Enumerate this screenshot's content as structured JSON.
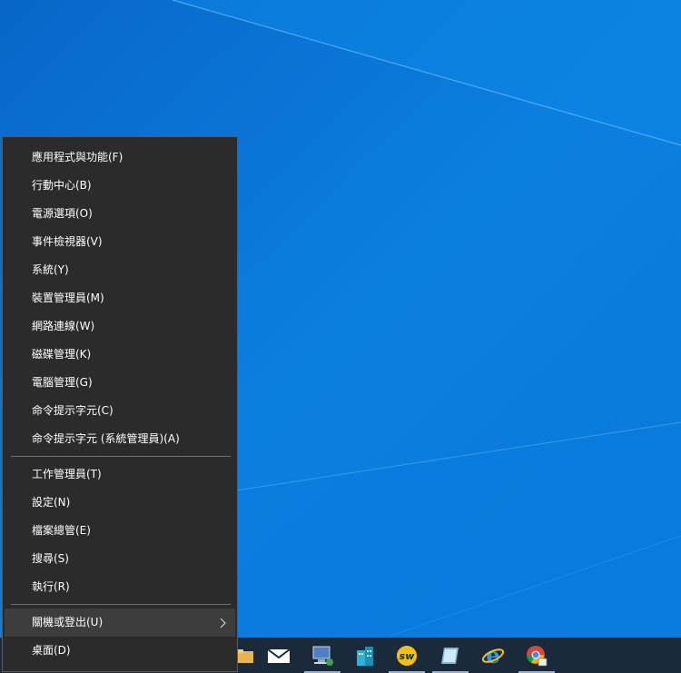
{
  "start_menu": {
    "group1": [
      {
        "label": "應用程式與功能(F)"
      },
      {
        "label": "行動中心(B)"
      },
      {
        "label": "電源選項(O)"
      },
      {
        "label": "事件檢視器(V)"
      },
      {
        "label": "系統(Y)"
      },
      {
        "label": "裝置管理員(M)"
      },
      {
        "label": "網路連線(W)"
      },
      {
        "label": "磁碟管理(K)"
      },
      {
        "label": "電腦管理(G)"
      },
      {
        "label": "命令提示字元(C)"
      },
      {
        "label": "命令提示字元 (系統管理員)(A)"
      }
    ],
    "group2": [
      {
        "label": "工作管理員(T)"
      },
      {
        "label": "設定(N)"
      },
      {
        "label": "檔案總管(E)"
      },
      {
        "label": "搜尋(S)"
      },
      {
        "label": "執行(R)"
      }
    ],
    "group3": [
      {
        "label": "關機或登出(U)",
        "has_submenu": true,
        "highlighted": true
      },
      {
        "label": "桌面(D)"
      }
    ]
  },
  "taskbar": {
    "icons": [
      {
        "name": "file-explorer-icon",
        "running": false
      },
      {
        "name": "mail-icon",
        "running": false
      },
      {
        "name": "network-computer-icon",
        "running": true
      },
      {
        "name": "building-app-icon",
        "running": false
      },
      {
        "name": "sw-app-icon",
        "running": true
      },
      {
        "name": "notepad-icon",
        "running": true
      },
      {
        "name": "internet-explorer-icon",
        "running": false
      },
      {
        "name": "chrome-icon",
        "running": true
      }
    ]
  },
  "colors": {
    "desktop_background": "#0a74d6",
    "menu_background": "#2b2b2b",
    "menu_highlight": "#3d3d3d",
    "taskbar_background": "#1b2a3a"
  }
}
